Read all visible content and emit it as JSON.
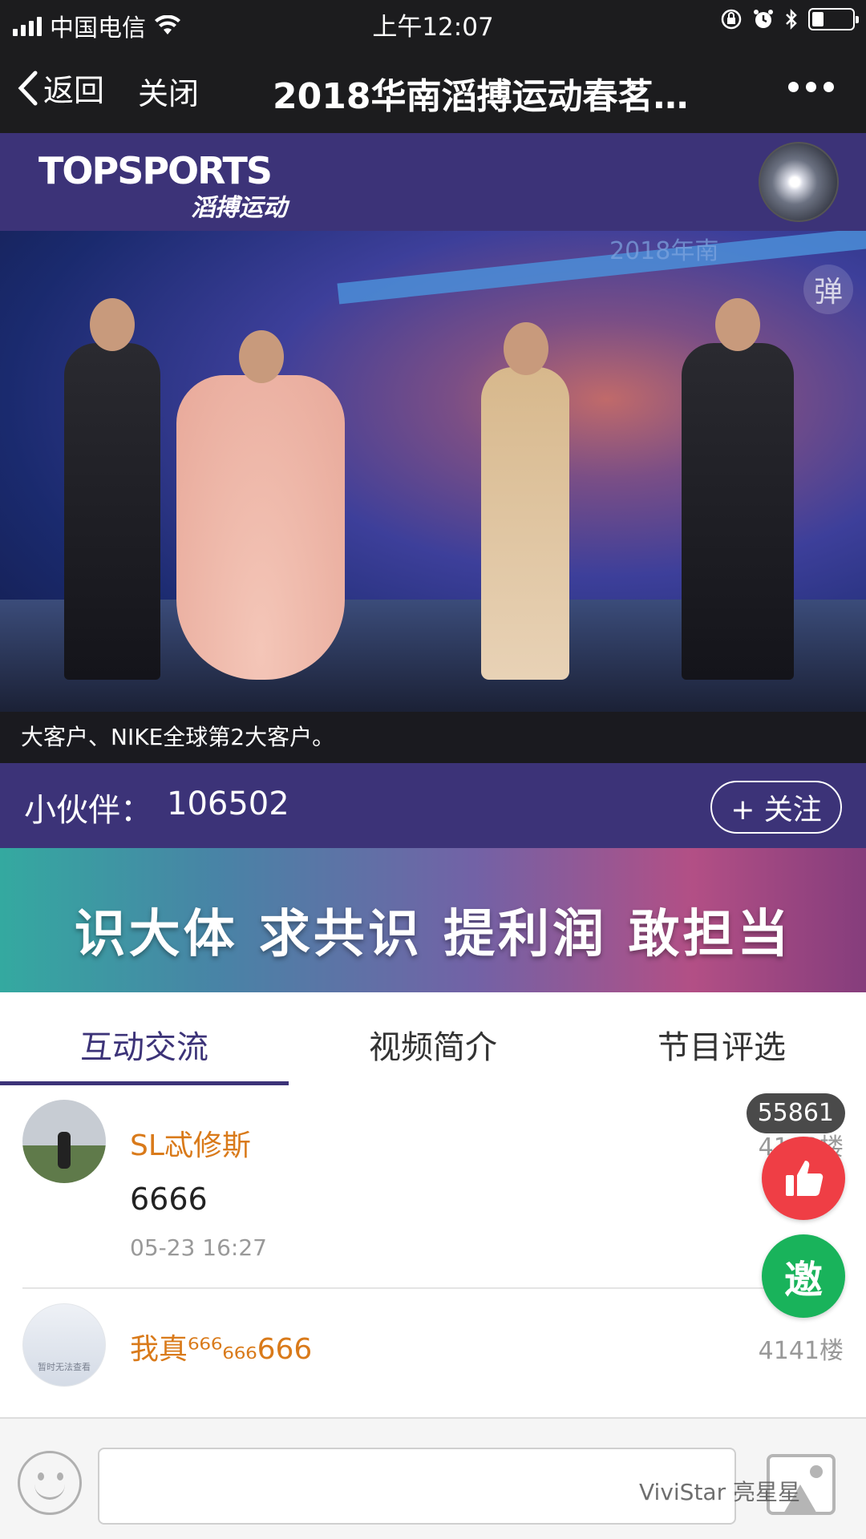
{
  "status_bar": {
    "carrier": "中国电信",
    "time": "上午12:07"
  },
  "nav": {
    "back_label": "返回",
    "close_label": "关闭",
    "title": "2018华南滔搏运动春茗…"
  },
  "brand": {
    "logo_main": "TOPSPORTS",
    "logo_sub": "滔搏运动"
  },
  "video": {
    "stage_text": "2018年南",
    "danmu_label": "弹",
    "caption": "大客户、NIKE全球第2大客户。"
  },
  "follow": {
    "label": "小伙伴：",
    "count": "106502",
    "button_label": "+ 关注"
  },
  "banner": {
    "slogan": "识大体 求共识 提利润 敢担当"
  },
  "tabs": [
    {
      "label": "互动交流",
      "active": true
    },
    {
      "label": "视频简介",
      "active": false
    },
    {
      "label": "节目评选",
      "active": false
    }
  ],
  "comments": [
    {
      "user": "SL忒修斯",
      "floor": "4142楼",
      "text": "6666",
      "time": "05-23 16:27"
    },
    {
      "user": "我真⁶⁶⁶₆₆₆666",
      "floor": "4141楼",
      "avatar_text": "暂时无法查看"
    }
  ],
  "floating": {
    "like_count": "55861",
    "invite_label": "邀"
  },
  "input": {
    "placeholder": ""
  },
  "watermark": "ViviStar 亮星星",
  "colors": {
    "brand_purple": "#3c3378",
    "username_orange": "#d97a1a",
    "like_red": "#ef3e45",
    "invite_green": "#19b35b"
  }
}
